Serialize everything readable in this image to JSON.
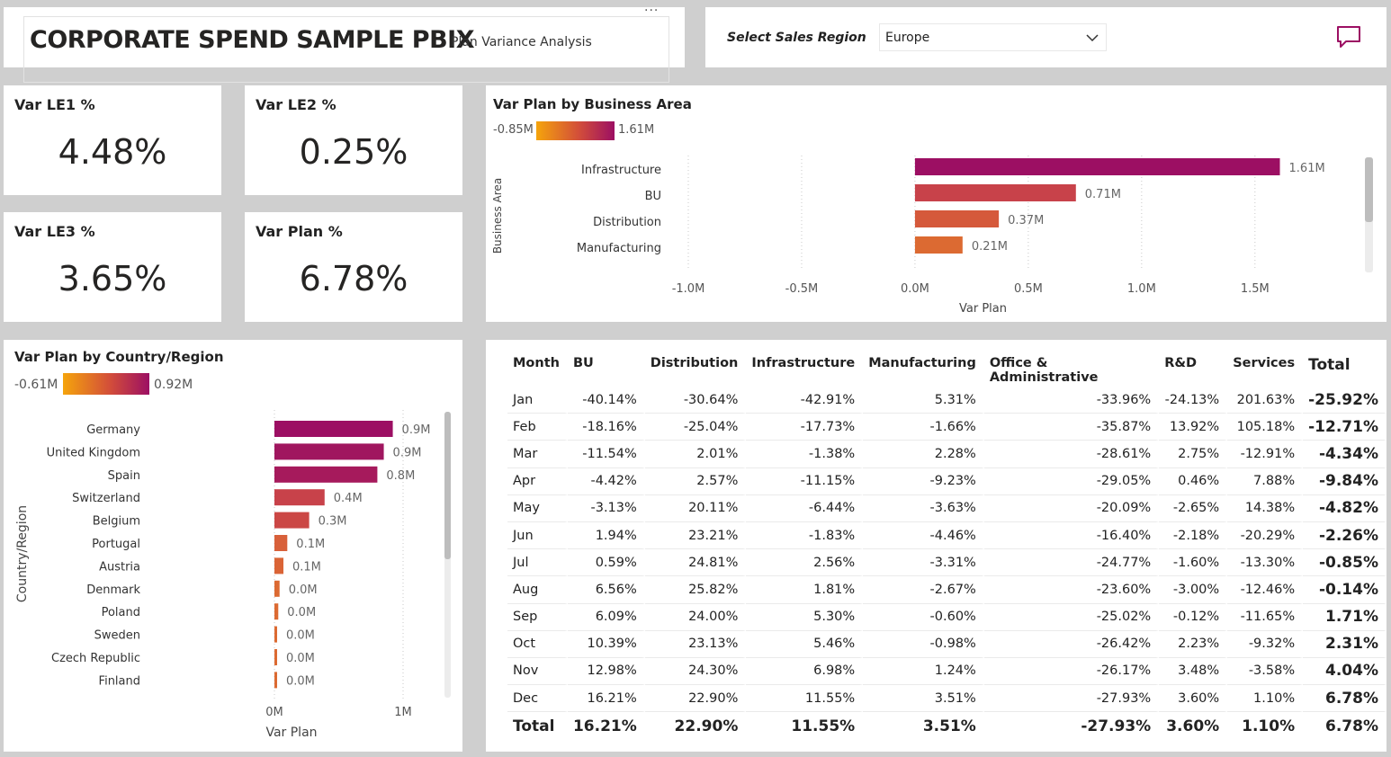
{
  "header": {
    "title": "CORPORATE SPEND SAMPLE PBIX",
    "subtitle": "Plan Variance Analysis",
    "more": "···"
  },
  "region": {
    "label": "Select Sales Region",
    "selected": "Europe"
  },
  "kpis": [
    {
      "title": "Var LE1 %",
      "value": "4.48%"
    },
    {
      "title": "Var LE2 %",
      "value": "0.25%"
    },
    {
      "title": "Var LE3 %",
      "value": "3.65%"
    },
    {
      "title": "Var Plan %",
      "value": "6.78%"
    }
  ],
  "colors": {
    "gradient_low": "#F5A40C",
    "gradient_mid": "#D24D3A",
    "gradient_high": "#9C0F63"
  },
  "chart_data": [
    {
      "type": "bar",
      "orientation": "horizontal",
      "title": "Var Plan by Business Area",
      "legend_min": "-0.85M",
      "legend_max": "1.61M",
      "ylabel": "Business Area",
      "xlabel": "Var Plan",
      "xlim": [
        -1.0,
        1.6
      ],
      "xticks": [
        "-1.0M",
        "-0.5M",
        "0.0M",
        "0.5M",
        "1.0M",
        "1.5M"
      ],
      "categories": [
        "Infrastructure",
        "BU",
        "Distribution",
        "Manufacturing"
      ],
      "values": [
        1.61,
        0.71,
        0.37,
        0.21
      ],
      "labels": [
        "1.61M",
        "0.71M",
        "0.37M",
        "0.21M"
      ],
      "colors": [
        "#9C0F63",
        "#C8424A",
        "#D5593B",
        "#DC6A32"
      ]
    },
    {
      "type": "bar",
      "orientation": "horizontal",
      "title": "Var Plan by Country/Region",
      "legend_min": "-0.61M",
      "legend_max": "0.92M",
      "ylabel": "Country/Region",
      "xlabel": "Var Plan",
      "xlim": [
        0,
        1.0
      ],
      "xticks": [
        "0M",
        "1M"
      ],
      "categories": [
        "Germany",
        "United Kingdom",
        "Spain",
        "Switzerland",
        "Belgium",
        "Portugal",
        "Austria",
        "Denmark",
        "Poland",
        "Sweden",
        "Czech Republic",
        "Finland"
      ],
      "values": [
        0.92,
        0.85,
        0.8,
        0.39,
        0.27,
        0.1,
        0.07,
        0.04,
        0.03,
        0.02,
        0.02,
        0.02
      ],
      "labels": [
        "0.9M",
        "0.9M",
        "0.8M",
        "0.4M",
        "0.3M",
        "0.1M",
        "0.1M",
        "0.0M",
        "0.0M",
        "0.0M",
        "0.0M",
        "0.0M"
      ],
      "colors": [
        "#9C0F63",
        "#A0165F",
        "#A61A5C",
        "#C8424A",
        "#CB4745",
        "#D8603A",
        "#DA6436",
        "#DC6A32",
        "#DC6A32",
        "#DC6A32",
        "#DC6A32",
        "#DC6A32"
      ]
    }
  ],
  "table": {
    "headers": [
      "Month",
      "BU",
      "Distribution",
      "Infrastructure",
      "Manufacturing",
      "Office & Administrative",
      "R&D",
      "Services",
      "Total"
    ],
    "rows": [
      [
        "Jan",
        "-40.14%",
        "-30.64%",
        "-42.91%",
        "5.31%",
        "-33.96%",
        "-24.13%",
        "201.63%",
        "-25.92%"
      ],
      [
        "Feb",
        "-18.16%",
        "-25.04%",
        "-17.73%",
        "-1.66%",
        "-35.87%",
        "13.92%",
        "105.18%",
        "-12.71%"
      ],
      [
        "Mar",
        "-11.54%",
        "2.01%",
        "-1.38%",
        "2.28%",
        "-28.61%",
        "2.75%",
        "-12.91%",
        "-4.34%"
      ],
      [
        "Apr",
        "-4.42%",
        "2.57%",
        "-11.15%",
        "-9.23%",
        "-29.05%",
        "0.46%",
        "7.88%",
        "-9.84%"
      ],
      [
        "May",
        "-3.13%",
        "20.11%",
        "-6.44%",
        "-3.63%",
        "-20.09%",
        "-2.65%",
        "14.38%",
        "-4.82%"
      ],
      [
        "Jun",
        "1.94%",
        "23.21%",
        "-1.83%",
        "-4.46%",
        "-16.40%",
        "-2.18%",
        "-20.29%",
        "-2.26%"
      ],
      [
        "Jul",
        "0.59%",
        "24.81%",
        "2.56%",
        "-3.31%",
        "-24.77%",
        "-1.60%",
        "-13.30%",
        "-0.85%"
      ],
      [
        "Aug",
        "6.56%",
        "25.82%",
        "1.81%",
        "-2.67%",
        "-23.60%",
        "-3.00%",
        "-12.46%",
        "-0.14%"
      ],
      [
        "Sep",
        "6.09%",
        "24.00%",
        "5.30%",
        "-0.60%",
        "-25.02%",
        "-0.12%",
        "-11.65%",
        "1.71%"
      ],
      [
        "Oct",
        "10.39%",
        "23.13%",
        "5.46%",
        "-0.98%",
        "-26.42%",
        "2.23%",
        "-9.32%",
        "2.31%"
      ],
      [
        "Nov",
        "12.98%",
        "24.30%",
        "6.98%",
        "1.24%",
        "-26.17%",
        "3.48%",
        "-3.58%",
        "4.04%"
      ],
      [
        "Dec",
        "16.21%",
        "22.90%",
        "11.55%",
        "3.51%",
        "-27.93%",
        "3.60%",
        "1.10%",
        "6.78%"
      ]
    ],
    "total": [
      "Total",
      "16.21%",
      "22.90%",
      "11.55%",
      "3.51%",
      "-27.93%",
      "3.60%",
      "1.10%",
      "6.78%"
    ]
  }
}
